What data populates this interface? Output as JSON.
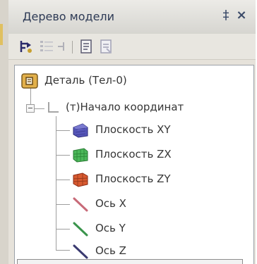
{
  "panel": {
    "title": "Дерево модели",
    "pin_glyph": "‡",
    "close_glyph": "×"
  },
  "toolbar": {
    "buttons": [
      {
        "icon": "build-tree-icon"
      },
      {
        "icon": "list-view-icon"
      },
      {
        "icon": "filter-icon"
      },
      {
        "icon": "document-icon"
      },
      {
        "icon": "properties-icon"
      }
    ]
  },
  "tree": {
    "root": {
      "label": "Деталь (Тел-0)",
      "icon": "part-icon"
    },
    "origin": {
      "label": "(т)Начало координат",
      "icon": "coordinate-origin-icon"
    },
    "children": [
      {
        "label": "Плоскость XY",
        "icon": "plane-xy-icon",
        "color": "#4a4aa8"
      },
      {
        "label": "Плоскость ZX",
        "icon": "plane-zx-icon",
        "color": "#3aa44a"
      },
      {
        "label": "Плоскость ZY",
        "icon": "plane-zy-icon",
        "color": "#d0502c"
      },
      {
        "label": "Ось X",
        "icon": "axis-x-icon",
        "color": "#c06070"
      },
      {
        "label": "Ось Y",
        "icon": "axis-y-icon",
        "color": "#3a8a4a"
      },
      {
        "label": "Ось Z",
        "icon": "axis-z-icon",
        "color": "#3a3a6a"
      }
    ]
  }
}
